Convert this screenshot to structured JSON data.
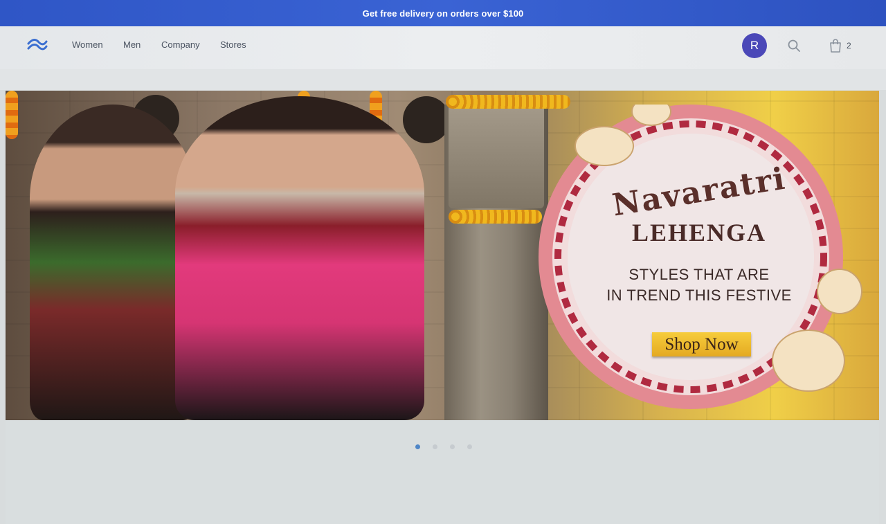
{
  "promo": {
    "text": "Get free delivery on orders over $100"
  },
  "nav": {
    "links": [
      {
        "label": "Women"
      },
      {
        "label": "Men"
      },
      {
        "label": "Company"
      },
      {
        "label": "Stores"
      }
    ],
    "avatar_initial": "R",
    "cart_count": "2"
  },
  "hero": {
    "title_line1": "Navaratri",
    "title_line2": "LEHENGA",
    "subtitle_line1": "STYLES THAT ARE",
    "subtitle_line2": "IN TREND THIS FESTIVE",
    "cta_label": "Shop Now"
  },
  "carousel": {
    "slides": 4,
    "active_index": 0
  },
  "colors": {
    "promo_bar": "#3a63d4",
    "avatar": "#4b48b8",
    "cta": "#f0c030",
    "active_dot": "#4f86c7"
  }
}
